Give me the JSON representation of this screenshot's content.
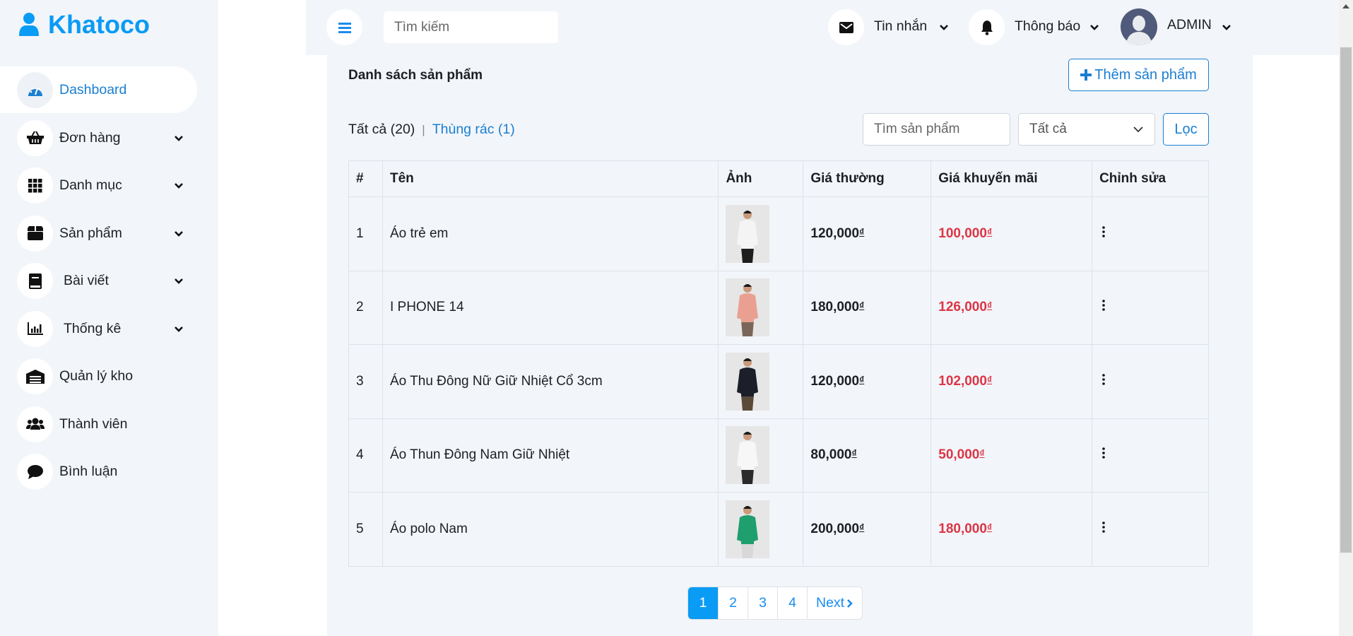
{
  "brand": {
    "name": "Khatoco",
    "color": "#0a9bf5"
  },
  "sidebar": {
    "items": [
      {
        "label": "Dashboard",
        "icon": "dashboard-gauge-icon",
        "active": true,
        "chevron": false
      },
      {
        "label": "Đơn hàng",
        "icon": "basket-icon",
        "chevron": true
      },
      {
        "label": "Danh mục",
        "icon": "grid-icon",
        "chevron": true
      },
      {
        "label": "Sản phẩm",
        "icon": "box-icon",
        "chevron": true
      },
      {
        "label": "Bài viết",
        "icon": "book-icon",
        "chevron": true,
        "indent": true
      },
      {
        "label": "Thống kê",
        "icon": "bar-chart-icon",
        "chevron": true,
        "indent": true
      },
      {
        "label": "Quản lý kho",
        "icon": "warehouse-icon",
        "chevron": false
      },
      {
        "label": "Thành viên",
        "icon": "users-icon",
        "chevron": false
      },
      {
        "label": "Bình luận",
        "icon": "comment-icon",
        "chevron": false
      }
    ]
  },
  "header": {
    "search_placeholder": "Tìm kiếm",
    "messages": "Tin nhắn",
    "notifications": "Thông báo",
    "user": "ADMIN"
  },
  "main": {
    "title": "Danh sách sản phẩm",
    "add_button": "Thêm sản phẩm",
    "tabs": {
      "all": "Tất cả (20)",
      "separator": "|",
      "trash": "Thùng rác (1)"
    },
    "filter": {
      "search_placeholder": "Tìm sản phẩm",
      "select_value": "Tất cả",
      "button": "Lọc"
    },
    "table": {
      "columns": [
        "#",
        "Tên",
        "Ảnh",
        "Giá thường",
        "Giá khuyến mãi",
        "Chỉnh sửa"
      ],
      "currency": "₫",
      "rows": [
        {
          "no": "1",
          "name": "Áo trẻ em",
          "price": "120,000",
          "sale": "100,000",
          "shirt": "#f4f4f4",
          "pants": "#1e1e1e"
        },
        {
          "no": "2",
          "name": "I PHONE 14",
          "price": "180,000",
          "sale": "126,000",
          "shirt": "#e9a090",
          "pants": "#7a6658"
        },
        {
          "no": "3",
          "name": "Áo Thu Đông Nữ Giữ Nhiệt Cổ 3cm",
          "price": "120,000",
          "sale": "102,000",
          "shirt": "#1c1f2a",
          "pants": "#5a4a3a"
        },
        {
          "no": "4",
          "name": "Áo Thun Đông Nam Giữ Nhiệt",
          "price": "80,000",
          "sale": "50,000",
          "shirt": "#f7f7f7",
          "pants": "#2a2a2a"
        },
        {
          "no": "5",
          "name": "Áo polo Nam",
          "price": "200,000",
          "sale": "180,000",
          "shirt": "#1f9e6e",
          "pants": "#d8d8d8"
        }
      ]
    },
    "pagination": {
      "pages": [
        "1",
        "2",
        "3",
        "4"
      ],
      "current": "1",
      "next": "Next"
    }
  },
  "colors": {
    "accent": "#1a7fd1",
    "sale": "#dc3545",
    "bg": "#f2f5f9"
  }
}
